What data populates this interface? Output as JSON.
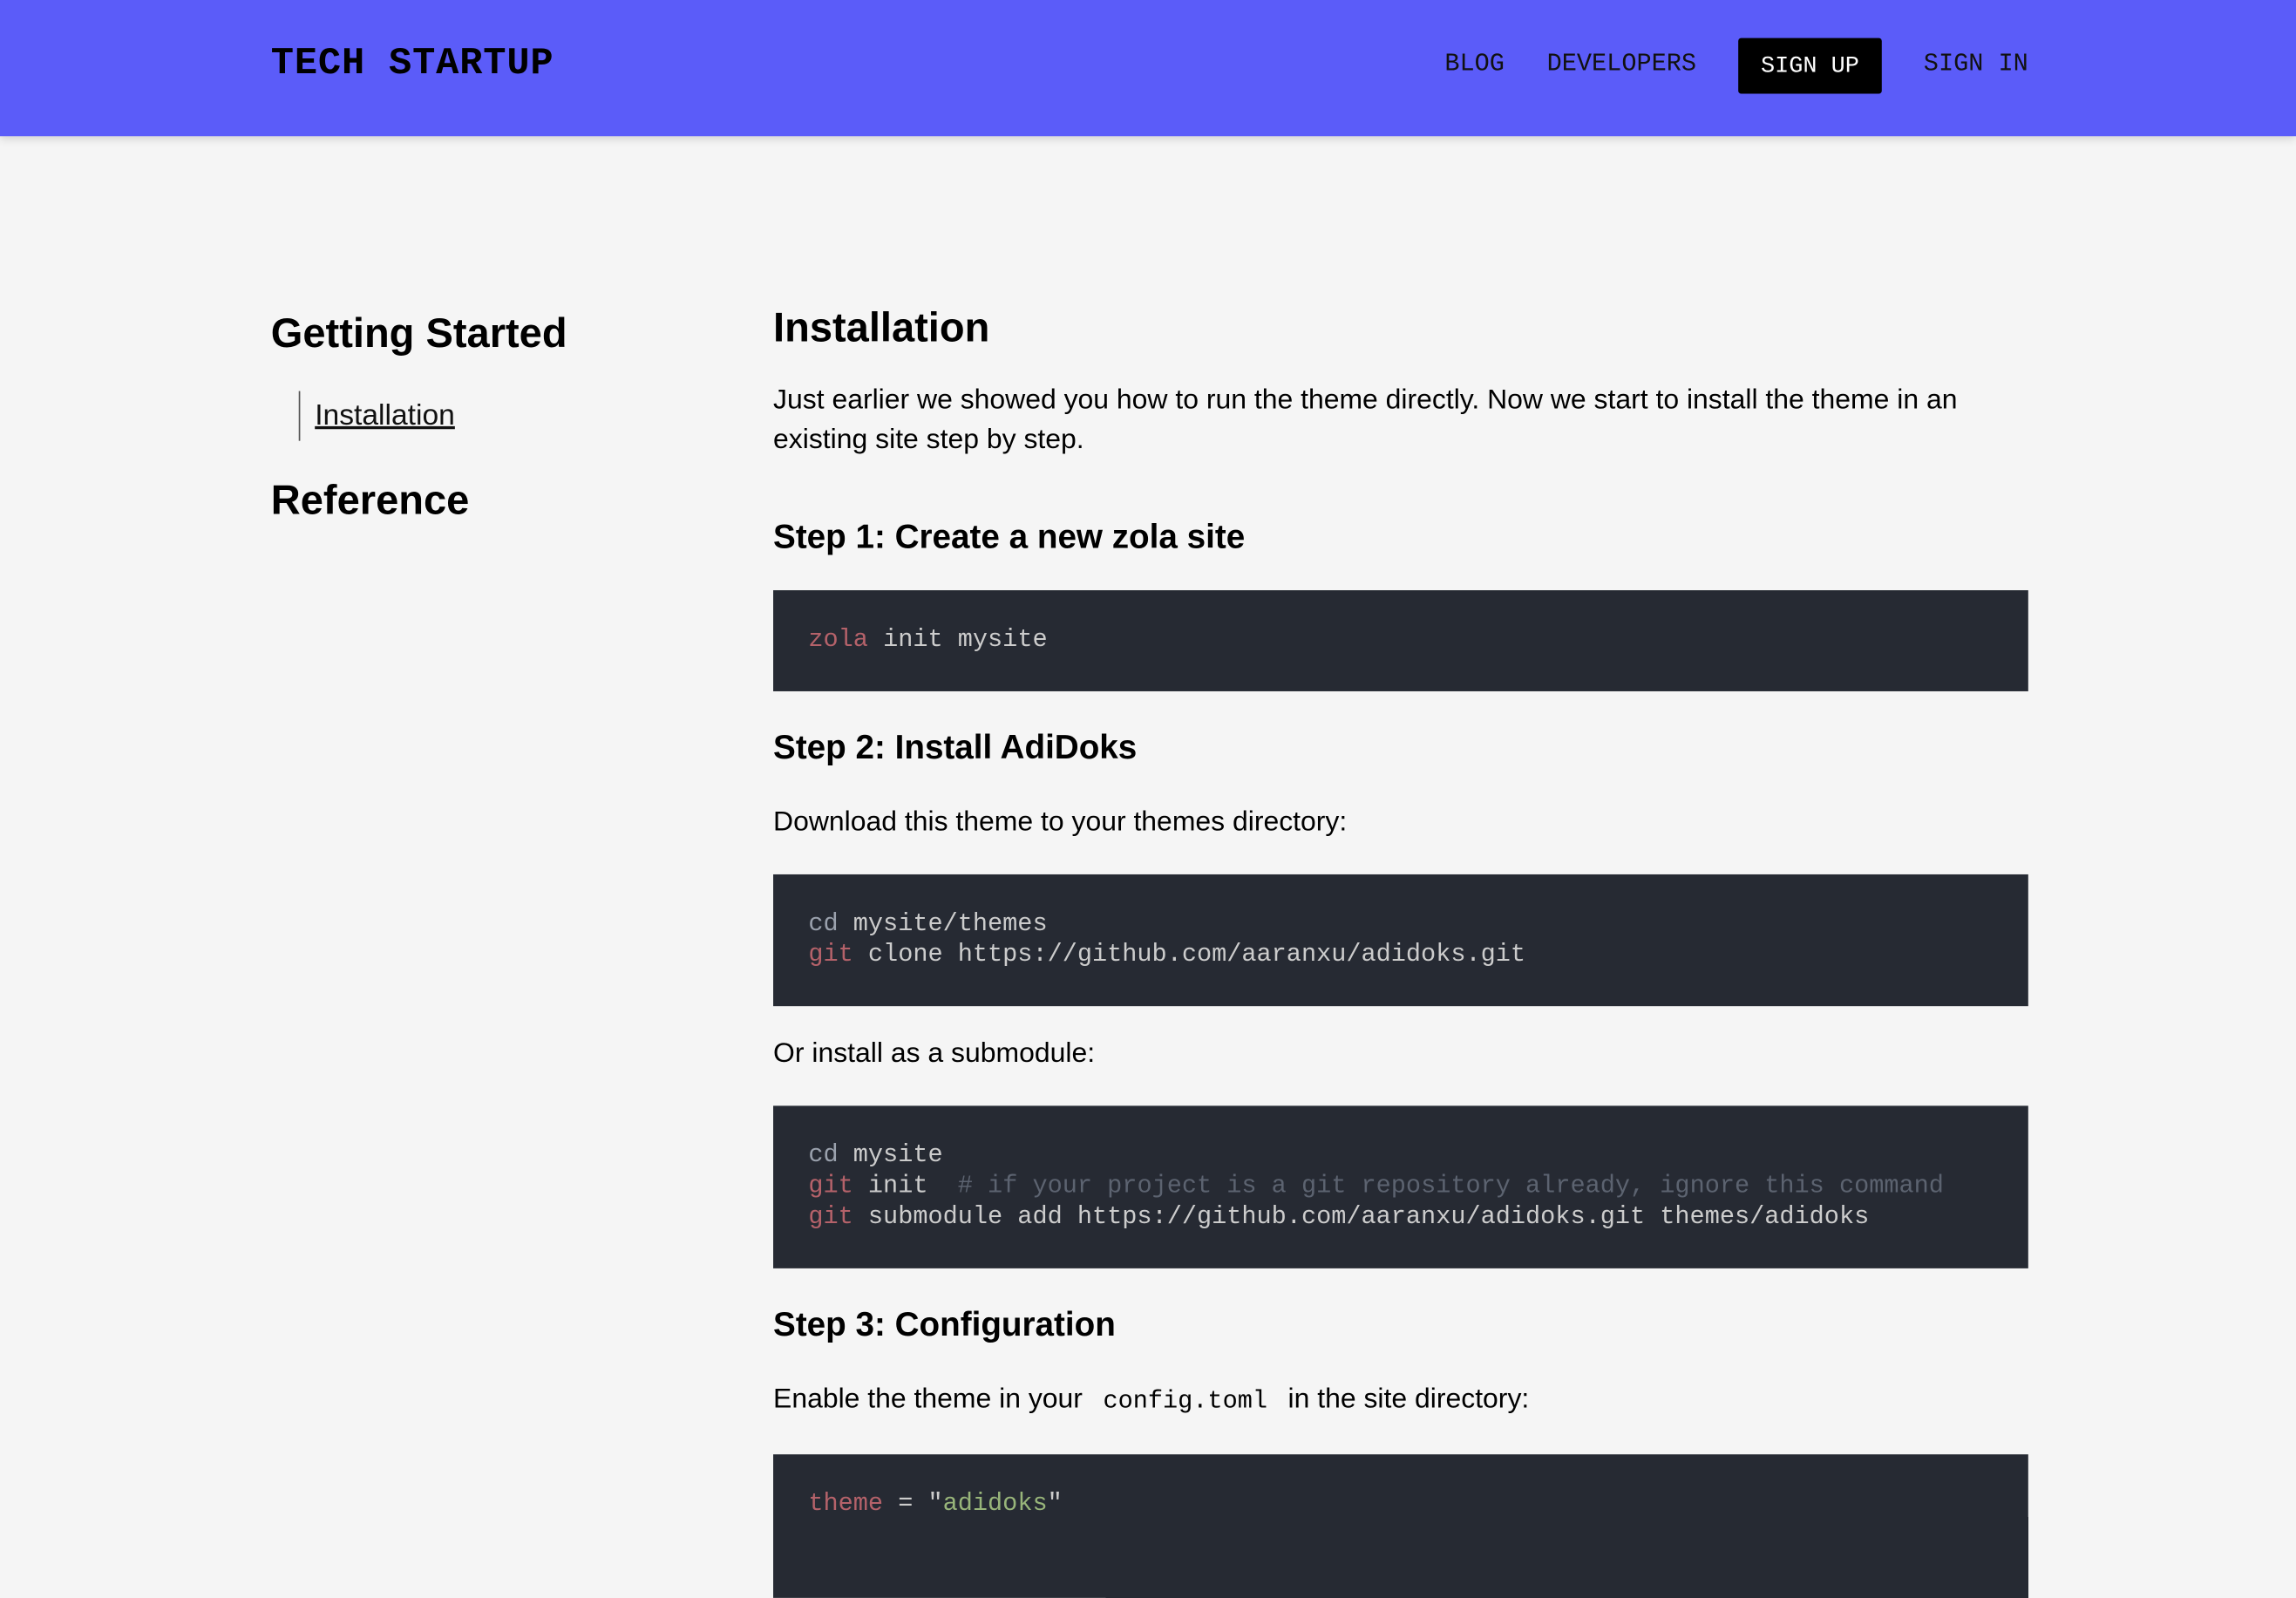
{
  "header": {
    "brand": "TECH STARTUP",
    "nav": {
      "blog": "BLOG",
      "developers": "DEVELOPERS",
      "signup": "SIGN UP",
      "signin": "SIGN IN"
    },
    "background_color": "#5b5cf9"
  },
  "sidebar": {
    "section1": "Getting Started",
    "section1_items": [
      "Installation"
    ],
    "section2": "Reference"
  },
  "main": {
    "title": "Installation",
    "intro": "Just earlier we showed you how to run the theme directly. Now we start to install the theme in an existing site step by step.",
    "step1": {
      "title": "Step 1: Create a new zola site",
      "code": {
        "cmd": "zola",
        "args": " init mysite"
      }
    },
    "step2": {
      "title": "Step 2: Install AdiDoks",
      "text": "Download this theme to your themes directory:",
      "code": {
        "l1_cmd": "cd",
        "l1_args": " mysite/themes",
        "l2_cmd": "git",
        "l2_args": " clone https://github.com/aaranxu/adidoks.git"
      },
      "text2": "Or install as a submodule:",
      "code2": {
        "l1_cmd": "cd",
        "l1_args": " mysite",
        "l2_cmd": "git",
        "l2_args": " init  ",
        "l2_comment": "# if your project is a git repository already, ignore this command",
        "l3_cmd": "git",
        "l3_args": " submodule add https://github.com/aaranxu/adidoks.git themes/adidoks"
      }
    },
    "step3": {
      "title": "Step 3: Configuration",
      "text_before": "Enable the theme in your",
      "inline_code": "config.toml",
      "text_after": "in the site directory:",
      "code": {
        "key": "theme",
        "op": " = ",
        "q1": "\"",
        "value": "adidoks",
        "q2": "\""
      }
    }
  }
}
